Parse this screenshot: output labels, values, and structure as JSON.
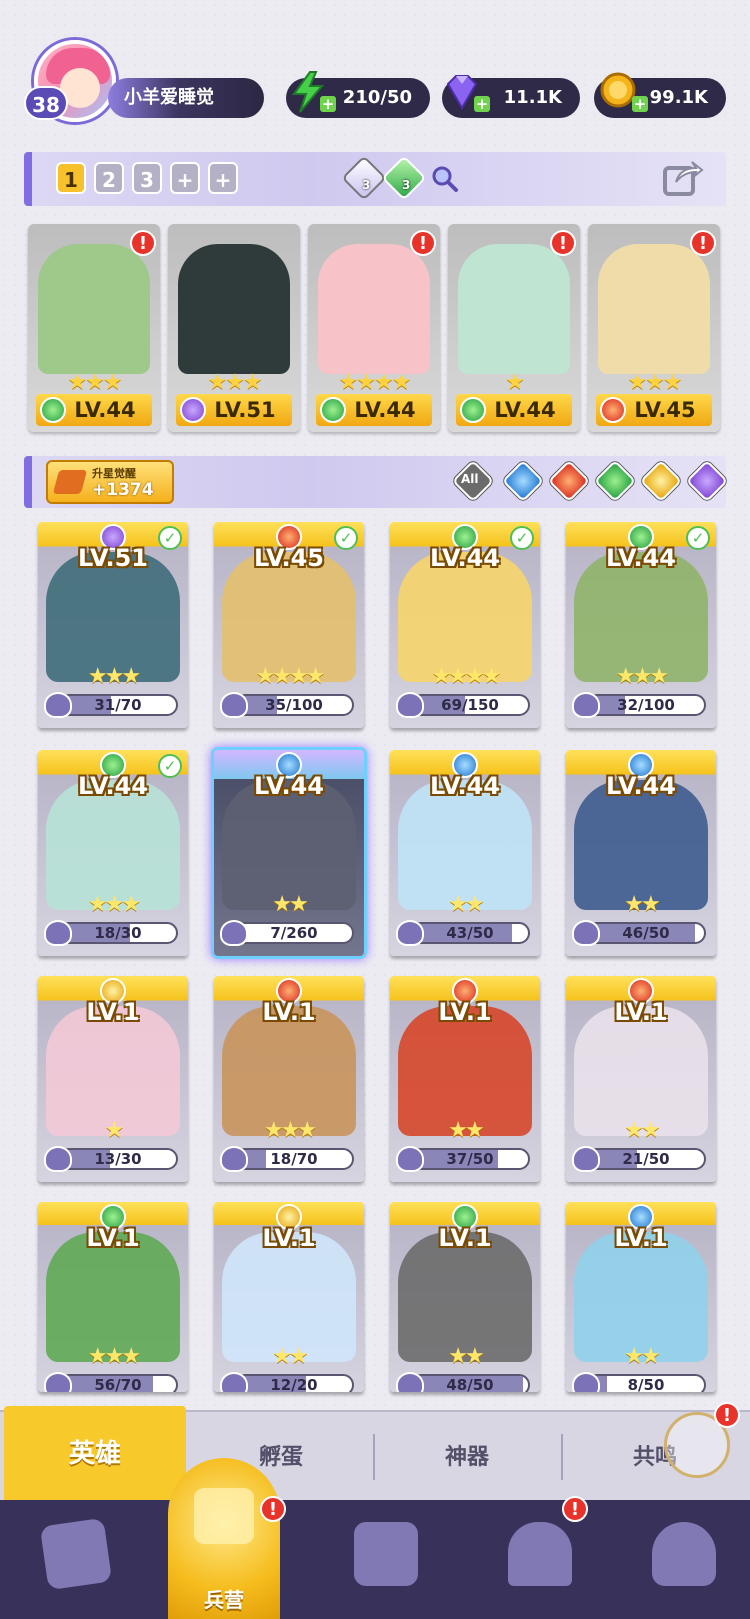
{
  "player": {
    "level": "38",
    "name": "小羊爱睡觉"
  },
  "resources": [
    {
      "name": "energy",
      "icon": "lightning-icon",
      "value": "210/50",
      "color": "#46d04a"
    },
    {
      "name": "gems",
      "icon": "diamond-icon",
      "value": "11.1K",
      "color": "#8a63f0"
    },
    {
      "name": "coins",
      "icon": "coin-icon",
      "value": "99.1K",
      "color": "#f5b51a"
    }
  ],
  "team_bar": {
    "tabs": [
      "1",
      "2",
      "3",
      "+",
      "+"
    ],
    "active_tab": "1",
    "gem_counts": [
      "3",
      "3"
    ]
  },
  "team": [
    {
      "level": "LV.44",
      "element": "wood",
      "stars": "★★★",
      "alert": "!"
    },
    {
      "level": "LV.51",
      "element": "dark",
      "stars": "★★★",
      "alert": ""
    },
    {
      "level": "LV.44",
      "element": "wood",
      "stars": "★★★★",
      "alert": "!"
    },
    {
      "level": "LV.44",
      "element": "wood",
      "stars": "★",
      "alert": "!"
    },
    {
      "level": "LV.45",
      "element": "fire",
      "stars": "★★★",
      "alert": "!"
    }
  ],
  "filter": {
    "awaken_label": "升星觉醒",
    "awaken_value": "+1374",
    "all_label": "All",
    "elements": [
      "water",
      "fire",
      "wood",
      "light",
      "dark"
    ]
  },
  "heroes": [
    {
      "level": "LV.51",
      "element": "dark",
      "stars": "★★★",
      "progress": "31/70",
      "ratio": 0.44,
      "checked": true,
      "selected": false,
      "art": "#3f6d7a"
    },
    {
      "level": "LV.45",
      "element": "fire",
      "stars": "★★★★",
      "progress": "35/100",
      "ratio": 0.35,
      "checked": true,
      "selected": false,
      "art": "#e3c06d"
    },
    {
      "level": "LV.44",
      "element": "wood",
      "stars": "★★★★",
      "progress": "69/150",
      "ratio": 0.46,
      "checked": true,
      "selected": false,
      "art": "#f6d56c"
    },
    {
      "level": "LV.44",
      "element": "wood",
      "stars": "★★★",
      "progress": "32/100",
      "ratio": 0.32,
      "checked": true,
      "selected": false,
      "art": "#8fb46a"
    },
    {
      "level": "LV.44",
      "element": "wood",
      "stars": "★★★",
      "progress": "18/30",
      "ratio": 0.6,
      "checked": true,
      "selected": false,
      "art": "#b7e2d6"
    },
    {
      "level": "LV.44",
      "element": "water",
      "stars": "★★",
      "progress": "7/260",
      "ratio": 0.03,
      "checked": false,
      "selected": true,
      "art": "#5d6172"
    },
    {
      "level": "LV.44",
      "element": "water",
      "stars": "★★",
      "progress": "43/50",
      "ratio": 0.86,
      "checked": false,
      "selected": false,
      "art": "#bfe3f6"
    },
    {
      "level": "LV.44",
      "element": "water",
      "stars": "★★",
      "progress": "46/50",
      "ratio": 0.92,
      "checked": false,
      "selected": false,
      "art": "#3e5c8e"
    },
    {
      "level": "LV.1",
      "element": "light",
      "stars": "★",
      "progress": "13/30",
      "ratio": 0.43,
      "checked": false,
      "selected": false,
      "art": "#f3c9d6"
    },
    {
      "level": "LV.1",
      "element": "fire",
      "stars": "★★★",
      "progress": "18/70",
      "ratio": 0.26,
      "checked": false,
      "selected": false,
      "art": "#c9955c"
    },
    {
      "level": "LV.1",
      "element": "fire",
      "stars": "★★",
      "progress": "37/50",
      "ratio": 0.74,
      "checked": false,
      "selected": false,
      "art": "#d6472a"
    },
    {
      "level": "LV.1",
      "element": "fire",
      "stars": "★★",
      "progress": "21/50",
      "ratio": 0.42,
      "checked": false,
      "selected": false,
      "art": "#e9e1ea"
    },
    {
      "level": "LV.1",
      "element": "wood",
      "stars": "★★★",
      "progress": "56/70",
      "ratio": 0.8,
      "checked": false,
      "selected": false,
      "art": "#5faa55"
    },
    {
      "level": "LV.1",
      "element": "light",
      "stars": "★★",
      "progress": "12/20",
      "ratio": 0.6,
      "checked": false,
      "selected": false,
      "art": "#cfe6fb"
    },
    {
      "level": "LV.1",
      "element": "wood",
      "stars": "★★",
      "progress": "48/50",
      "ratio": 0.96,
      "checked": false,
      "selected": false,
      "art": "#6b6b6b"
    },
    {
      "level": "LV.1",
      "element": "water",
      "stars": "★★",
      "progress": "8/50",
      "ratio": 0.16,
      "checked": false,
      "selected": false,
      "art": "#8fd2ea"
    }
  ],
  "subtabs": [
    {
      "label": "英雄",
      "active": true
    },
    {
      "label": "孵蛋",
      "active": false
    },
    {
      "label": "神器",
      "active": false
    },
    {
      "label": "共鸣",
      "active": false
    }
  ],
  "nav": {
    "active_label": "兵营",
    "items": [
      "cards-icon",
      "barracks-icon",
      "map-icon",
      "shop-icon",
      "character-icon"
    ],
    "alerts": [
      "",
      "!",
      "",
      "!",
      ""
    ]
  }
}
